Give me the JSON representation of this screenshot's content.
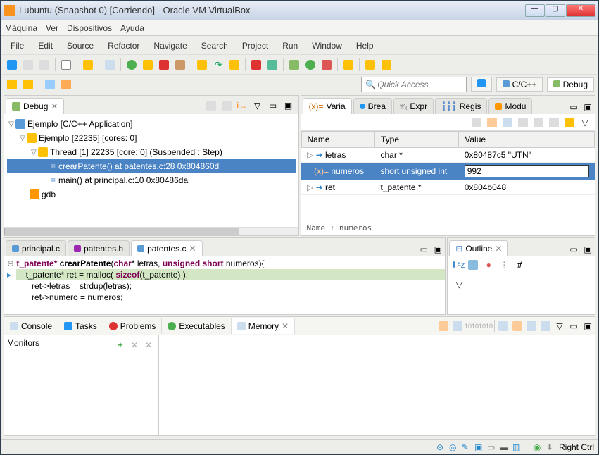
{
  "window": {
    "title": "Lubuntu (Snapshot 0) [Corriendo] - Oracle VM VirtualBox"
  },
  "vbox_menu": [
    "Máquina",
    "Ver",
    "Dispositivos",
    "Ayuda"
  ],
  "eclipse_menu": [
    "File",
    "Edit",
    "Source",
    "Refactor",
    "Navigate",
    "Search",
    "Project",
    "Run",
    "Window",
    "Help"
  ],
  "quick_access": {
    "placeholder": "Quick Access"
  },
  "perspectives": {
    "cpp": "C/C++",
    "debug": "Debug"
  },
  "debug_view": {
    "tab": "Debug",
    "tree": {
      "root": "Ejemplo [C/C++ Application]",
      "process": "Ejemplo [22235] [cores: 0]",
      "thread": "Thread [1] 22235 [core: 0] (Suspended : Step)",
      "frame0": "crearPatente() at patentes.c:28 0x804860d",
      "frame1": "main() at principal.c:10 0x80486da",
      "gdb": "gdb"
    }
  },
  "vars_view": {
    "tabs": [
      "Varia",
      "Brea",
      "Expr",
      "Regis",
      "Modu"
    ],
    "headers": {
      "name": "Name",
      "type": "Type",
      "value": "Value"
    },
    "rows": [
      {
        "name": "letras",
        "type": "char *",
        "value": "0x80487c5 \"UTN\""
      },
      {
        "name": "numeros",
        "type": "short unsigned int",
        "value": "992"
      },
      {
        "name": "ret",
        "type": "t_patente *",
        "value": "0x804b048"
      }
    ],
    "detail": "Name : numeros"
  },
  "editors": {
    "tabs": [
      "principal.c",
      "patentes.h",
      "patentes.c"
    ],
    "active": 2,
    "code": {
      "l1a": "t_patente* ",
      "l1b": "crearPatente",
      "l1c": "(",
      "l1d": "char",
      "l1e": "* letras, ",
      "l1f": "unsigned short",
      "l1g": " numeros){",
      "l2a": "    t_patente* ret = malloc( ",
      "l2b": "sizeof",
      "l2c": "(t_patente) );",
      "l3": "    ret->letras = strdup(letras);",
      "l4": "    ret->numero = numeros;"
    }
  },
  "outline": {
    "tab": "Outline"
  },
  "bottom": {
    "tabs": [
      "Console",
      "Tasks",
      "Problems",
      "Executables",
      "Memory"
    ],
    "active": 4,
    "monitors": "Monitors"
  },
  "statusbar": {
    "host": "Right Ctrl"
  }
}
